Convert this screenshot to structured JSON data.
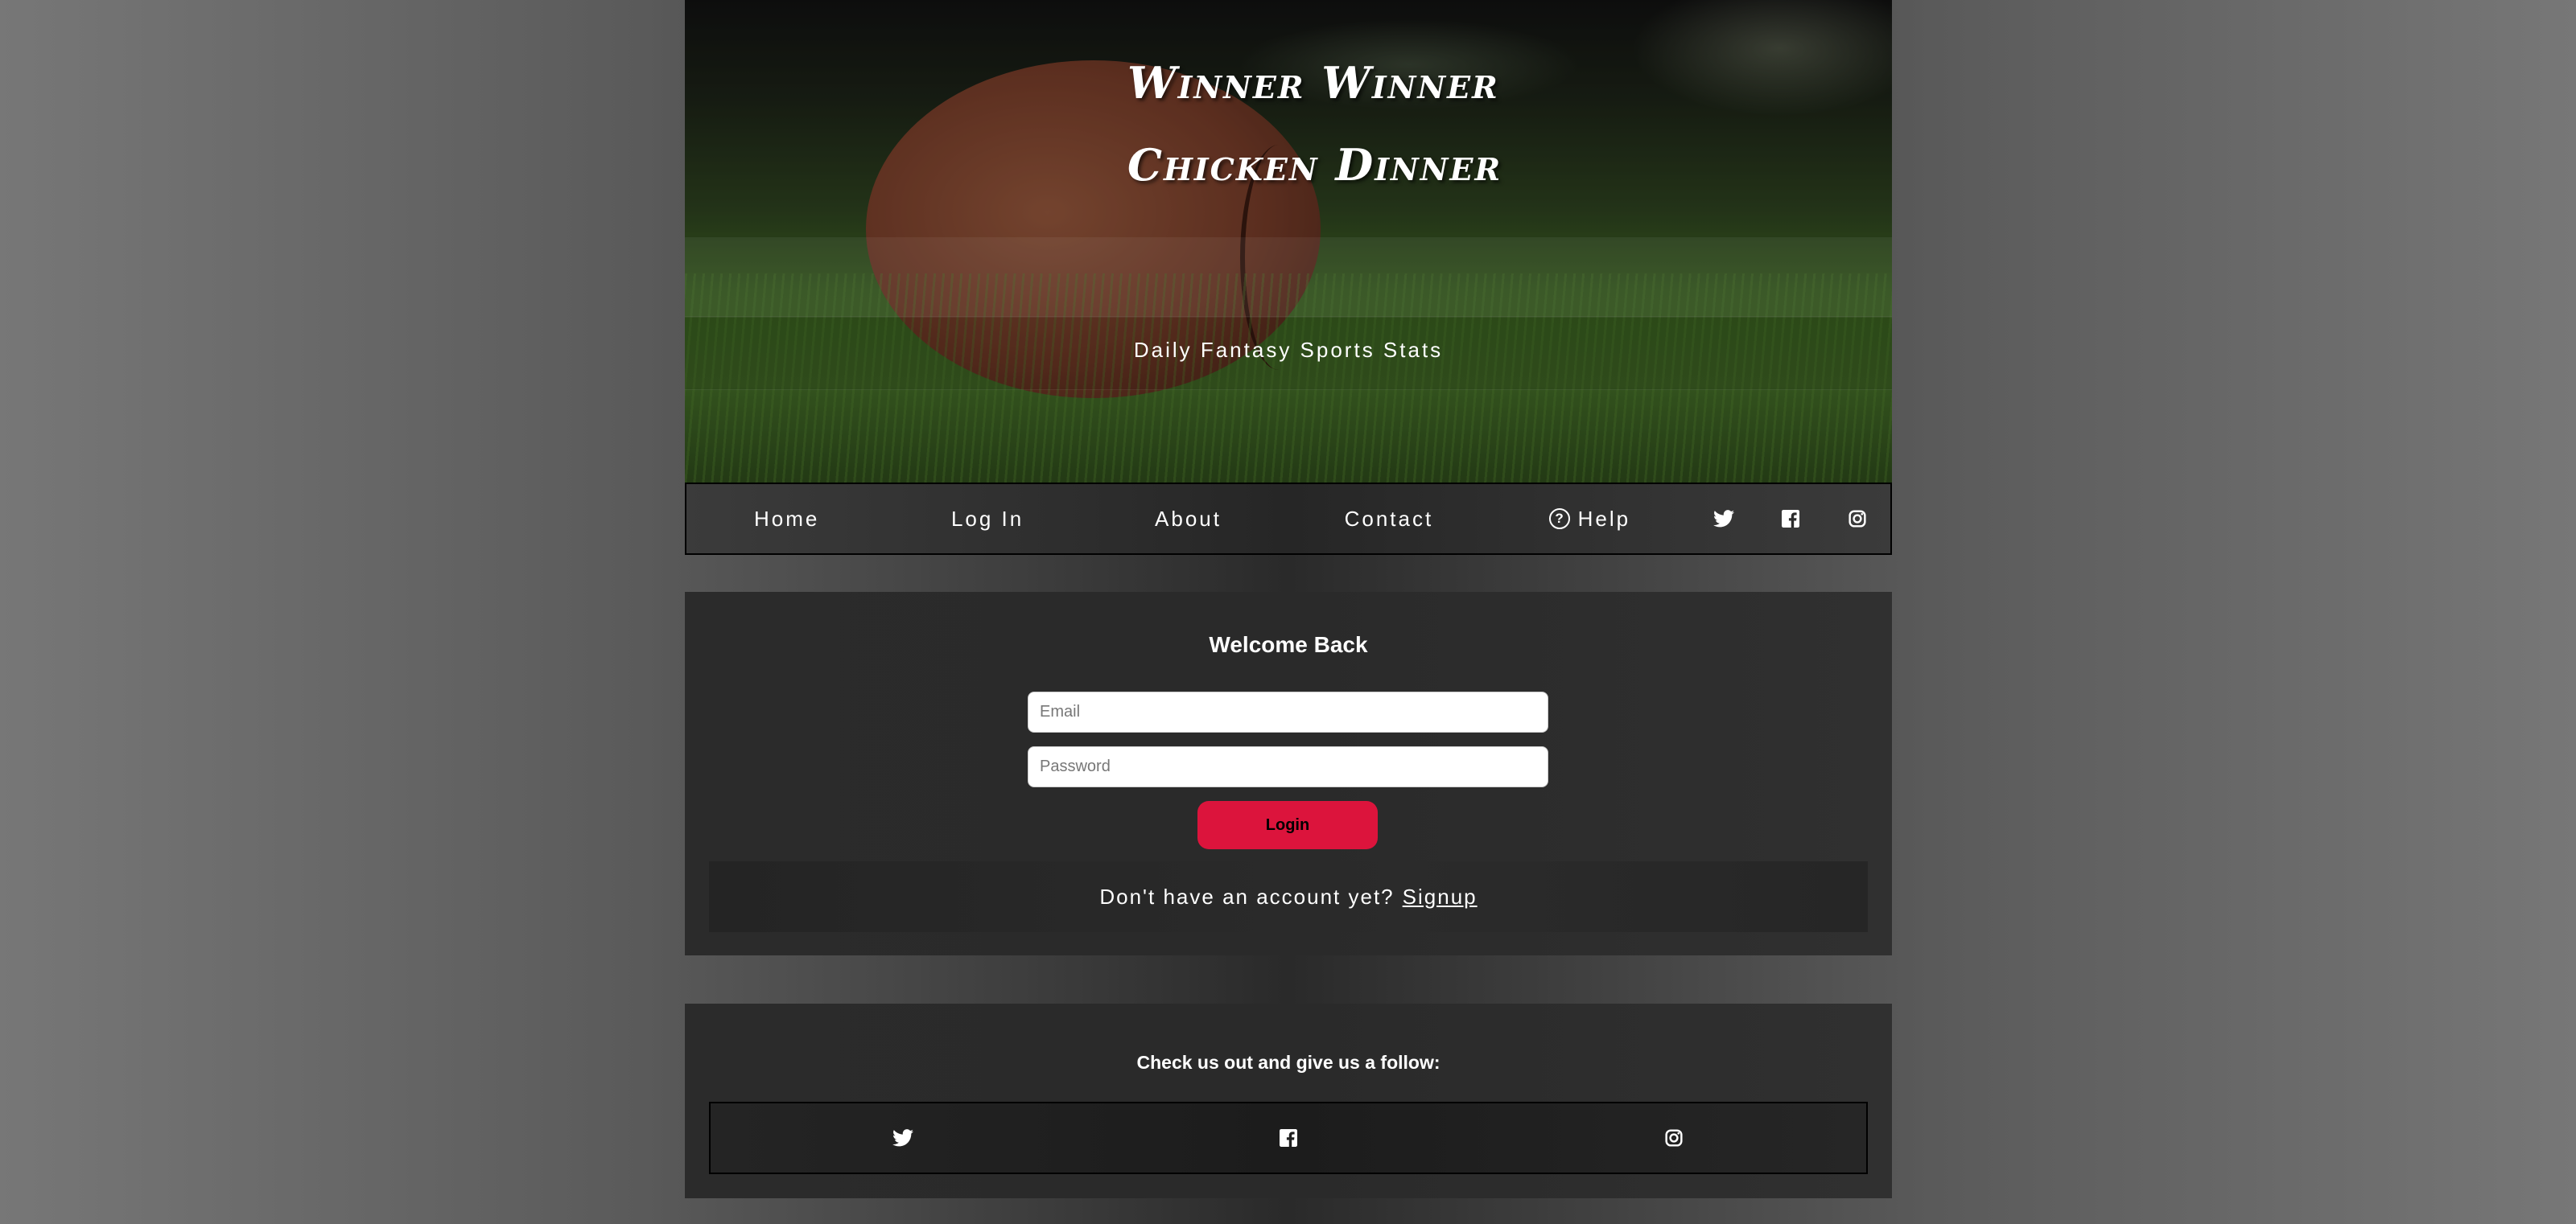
{
  "hero": {
    "title_line1": "Winner Winner",
    "title_line2": "Chicken Dinner",
    "subtitle": "Daily Fantasy Sports Stats"
  },
  "nav": {
    "home": "Home",
    "login": "Log In",
    "about": "About",
    "contact": "Contact",
    "help": "Help",
    "icons": [
      "twitter-icon",
      "facebook-icon",
      "instagram-icon"
    ]
  },
  "login_form": {
    "heading": "Welcome Back",
    "email_placeholder": "Email",
    "email_value": "",
    "password_placeholder": "Password",
    "password_value": "",
    "button_label": "Login",
    "signup_prompt": "Don't have an account yet?",
    "signup_link": "Signup"
  },
  "follow": {
    "heading": "Check us out and give us a follow:",
    "icons": [
      "twitter-icon",
      "facebook-icon",
      "instagram-icon"
    ]
  },
  "colors": {
    "accent": "#dc143c",
    "text": "#ffffff",
    "card_bg": "#2b2b2b"
  }
}
